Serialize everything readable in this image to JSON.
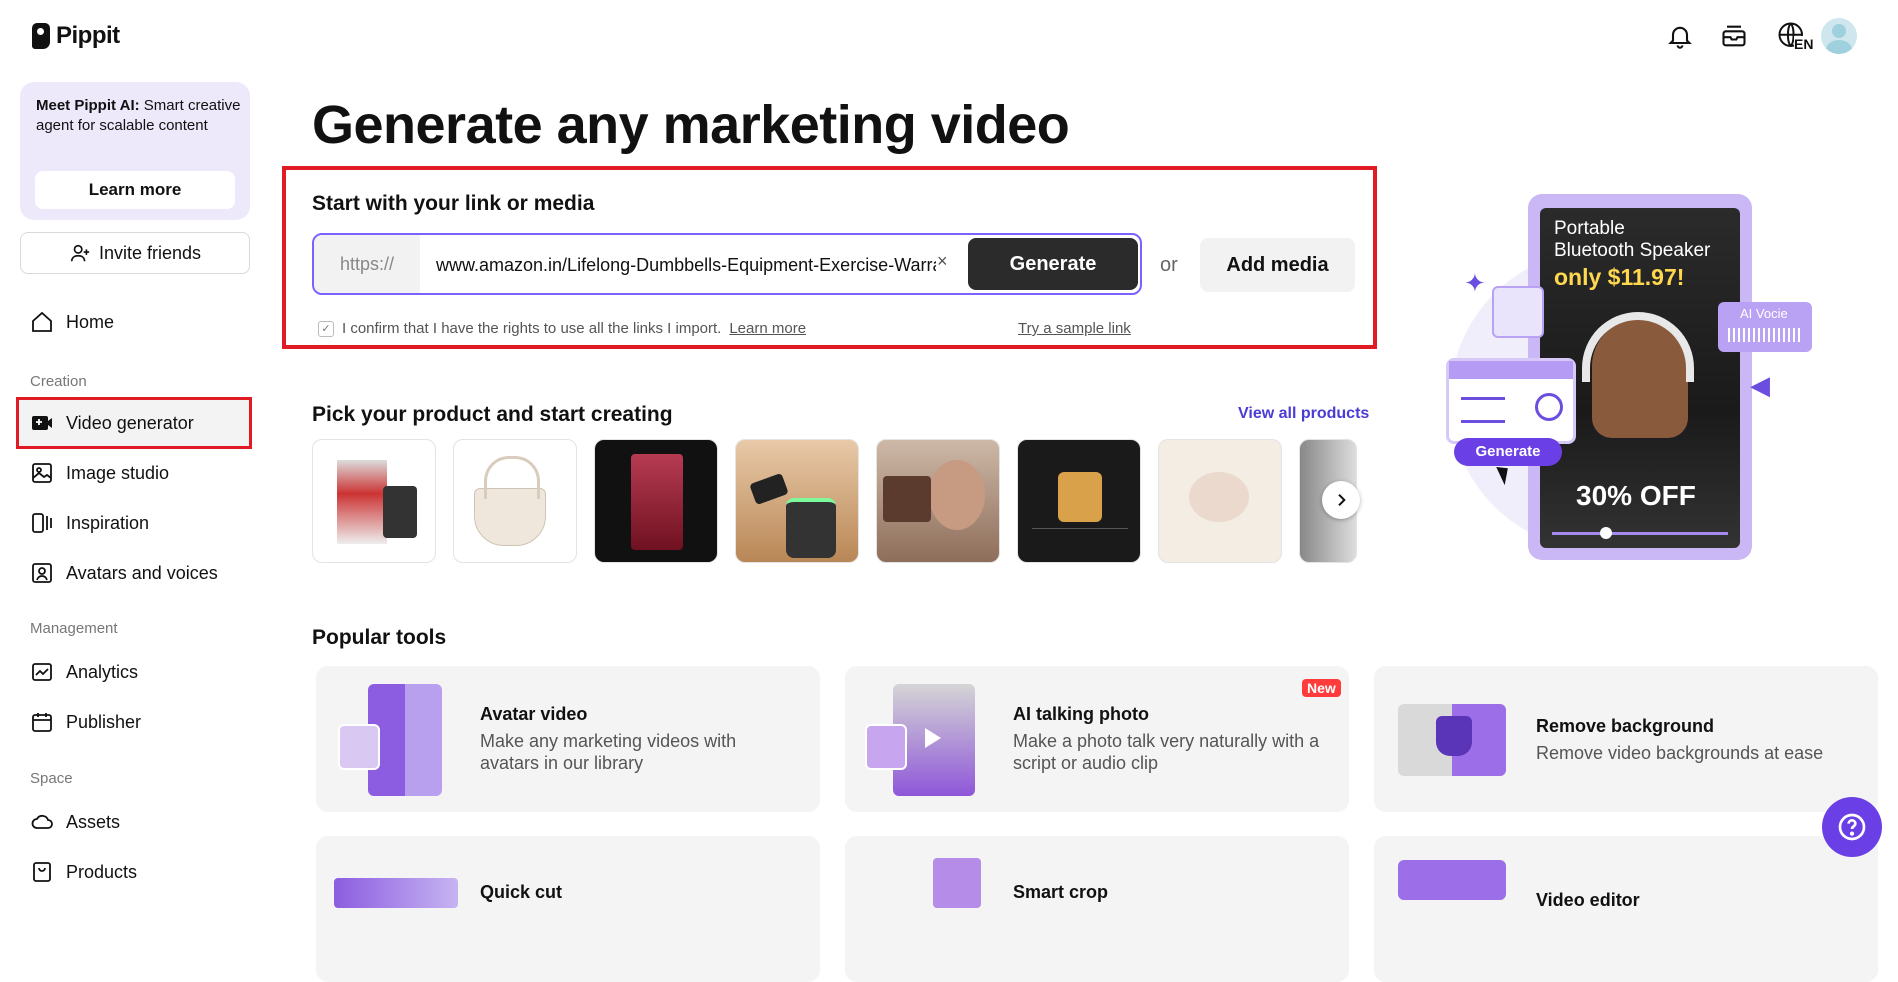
{
  "app": {
    "name": "Pippit"
  },
  "sidebar": {
    "promo": {
      "title_bold": "Meet Pippit AI:",
      "title_rest": " Smart creative agent for scalable content",
      "button": "Learn more"
    },
    "invite": "Invite friends",
    "home": "Home",
    "sections": {
      "creation": "Creation",
      "management": "Management",
      "space": "Space"
    },
    "creation_items": [
      "Video generator",
      "Image studio",
      "Inspiration",
      "Avatars and voices"
    ],
    "management_items": [
      "Analytics",
      "Publisher"
    ],
    "space_items": [
      "Assets",
      "Products"
    ],
    "active_item": "Video generator"
  },
  "header": {
    "icons": [
      "bell-icon",
      "inbox-icon",
      "globe-language-icon",
      "avatar"
    ],
    "language": "EN"
  },
  "main": {
    "title": "Generate any marketing video",
    "link_section": {
      "title": "Start with your link or media",
      "url_prefix": "https://",
      "url_value": "www.amazon.in/Lifelong-Dumbbells-Equipment-Exercise-Warranty",
      "clear": "×",
      "generate": "Generate",
      "or": "or",
      "add_media": "Add media",
      "confirm_text": "I confirm that I have the rights to use all the links I import.",
      "confirm_link": "Learn more",
      "sample_link": "Try a sample link"
    },
    "products": {
      "title": "Pick your product and start creating",
      "view_all": "View all products",
      "thumbnails": [
        "product-box",
        "white-handbag",
        "crystal-glass",
        "speaker-ad",
        "makeup-palette",
        "candle-lamp",
        "flowers",
        "partial-product"
      ]
    },
    "popular": {
      "title": "Popular tools",
      "tools": [
        {
          "name": "Avatar video",
          "desc": "Make any marketing videos with avatars in our library"
        },
        {
          "name": "AI talking photo",
          "desc": "Make a photo talk very naturally with a script or audio clip",
          "badge": "New"
        },
        {
          "name": "Remove background",
          "desc": "Remove video backgrounds at ease"
        },
        {
          "name": "Quick cut",
          "desc": ""
        },
        {
          "name": "Smart crop",
          "desc": ""
        },
        {
          "name": "Video editor",
          "desc": ""
        }
      ]
    },
    "hero": {
      "line1": "Portable",
      "line2": "Bluetooth Speaker",
      "price": "only $11.97!",
      "discount": "30% OFF",
      "voice_tag": "AI Vocie",
      "generate": "Generate"
    }
  },
  "colors": {
    "accent": "#7b61ff",
    "highlight": "#e01b24",
    "help": "#6b3fe6",
    "promo_bg": "#ede9fb"
  }
}
